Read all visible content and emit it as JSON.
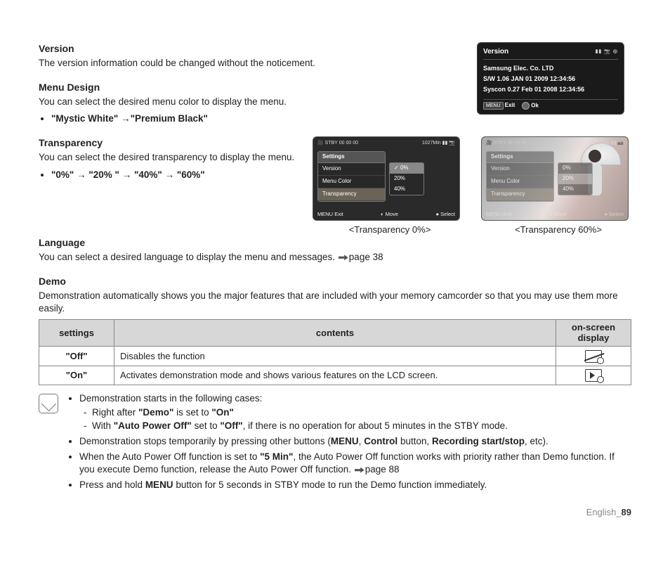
{
  "version": {
    "heading": "Version",
    "desc": "The version information could be changed without the noticement.",
    "lcd": {
      "title": "Version",
      "l1": "Samsung Elec. Co. LTD",
      "l2": "S/W 1.06 JAN 01 2009 12:34:56",
      "l3": "Syscon 0.27 Feb 01 2008 12:34:56",
      "exit_badge": "MENU",
      "exit": "Exit",
      "ok": "Ok"
    }
  },
  "menu_design": {
    "heading": "Menu Design",
    "desc": "You can select the desired menu color to display the menu.",
    "opt1": "\"Mystic White\"",
    "arrow": "→",
    "opt2": "\"Premium Black\""
  },
  "transparency": {
    "heading": "Transparency",
    "desc": "You can select the desired transparency to display the menu.",
    "seq_prefix": "",
    "o0": "\"0%\"",
    "o20": "\"20% \"",
    "o40": "\"40%\"",
    "o60": "\"60%\"",
    "arrow": "→",
    "caption0": "<Transparency 0%>",
    "caption60": "<Transparency 60%>",
    "lcd": {
      "status_left": "STBY 00 00 00",
      "status_right": "1027Min",
      "tab": "Settings",
      "m1": "Version",
      "m2": "Menu Color",
      "m3": "Transparency",
      "s0": "0%",
      "s20": "20%",
      "s40": "40%",
      "exit_badge": "MENU",
      "exit": "Exit",
      "move": "Move",
      "select": "Select"
    }
  },
  "language": {
    "heading": "Language",
    "desc": "You can select a desired language to display the menu and messages. ",
    "pageref": "page 38"
  },
  "demo": {
    "heading": "Demo",
    "desc": "Demonstration automatically shows you the major features that are included with your memory camcorder so that you may use them more easily.",
    "table": {
      "h_settings": "settings",
      "h_contents": "contents",
      "h_osd": "on-screen display",
      "rows": [
        {
          "setting": "\"Off\"",
          "content": "Disables the function",
          "icon": "off"
        },
        {
          "setting": "\"On\"",
          "content": "Activates demonstration mode and shows various features on the LCD screen.",
          "icon": "on"
        }
      ]
    },
    "notes": {
      "n1": "Demonstration starts in the following cases:",
      "n1a_pre": "Right after ",
      "n1a_b1": "\"Demo\"",
      "n1a_mid": " is set to ",
      "n1a_b2": "\"On\"",
      "n1b_pre": "With ",
      "n1b_b1": "\"Auto Power Off\"",
      "n1b_mid": " set to ",
      "n1b_b2": "\"Off\"",
      "n1b_post": ", if there is no operation for about 5 minutes in the STBY mode.",
      "n2_pre": "Demonstration stops temporarily by pressing other buttons (",
      "n2_b1": "MENU",
      "n2_c1": ", ",
      "n2_b2": "Control",
      "n2_c2": " button, ",
      "n2_b3": "Recording start/stop",
      "n2_post": ", etc).",
      "n3_pre": "When the Auto Power Off function is set to ",
      "n3_b1": "\"5 Min\"",
      "n3_post": ", the Auto Power Off function works with priority rather than Demo function. If you execute Demo function, release the Auto Power Off function. ",
      "n3_ref": "page 88",
      "n4_pre": "Press and hold ",
      "n4_b1": "MENU",
      "n4_post": " button for 5 seconds in STBY mode to run the Demo function immediately."
    }
  },
  "footer": {
    "lang": "English_",
    "page": "89"
  }
}
